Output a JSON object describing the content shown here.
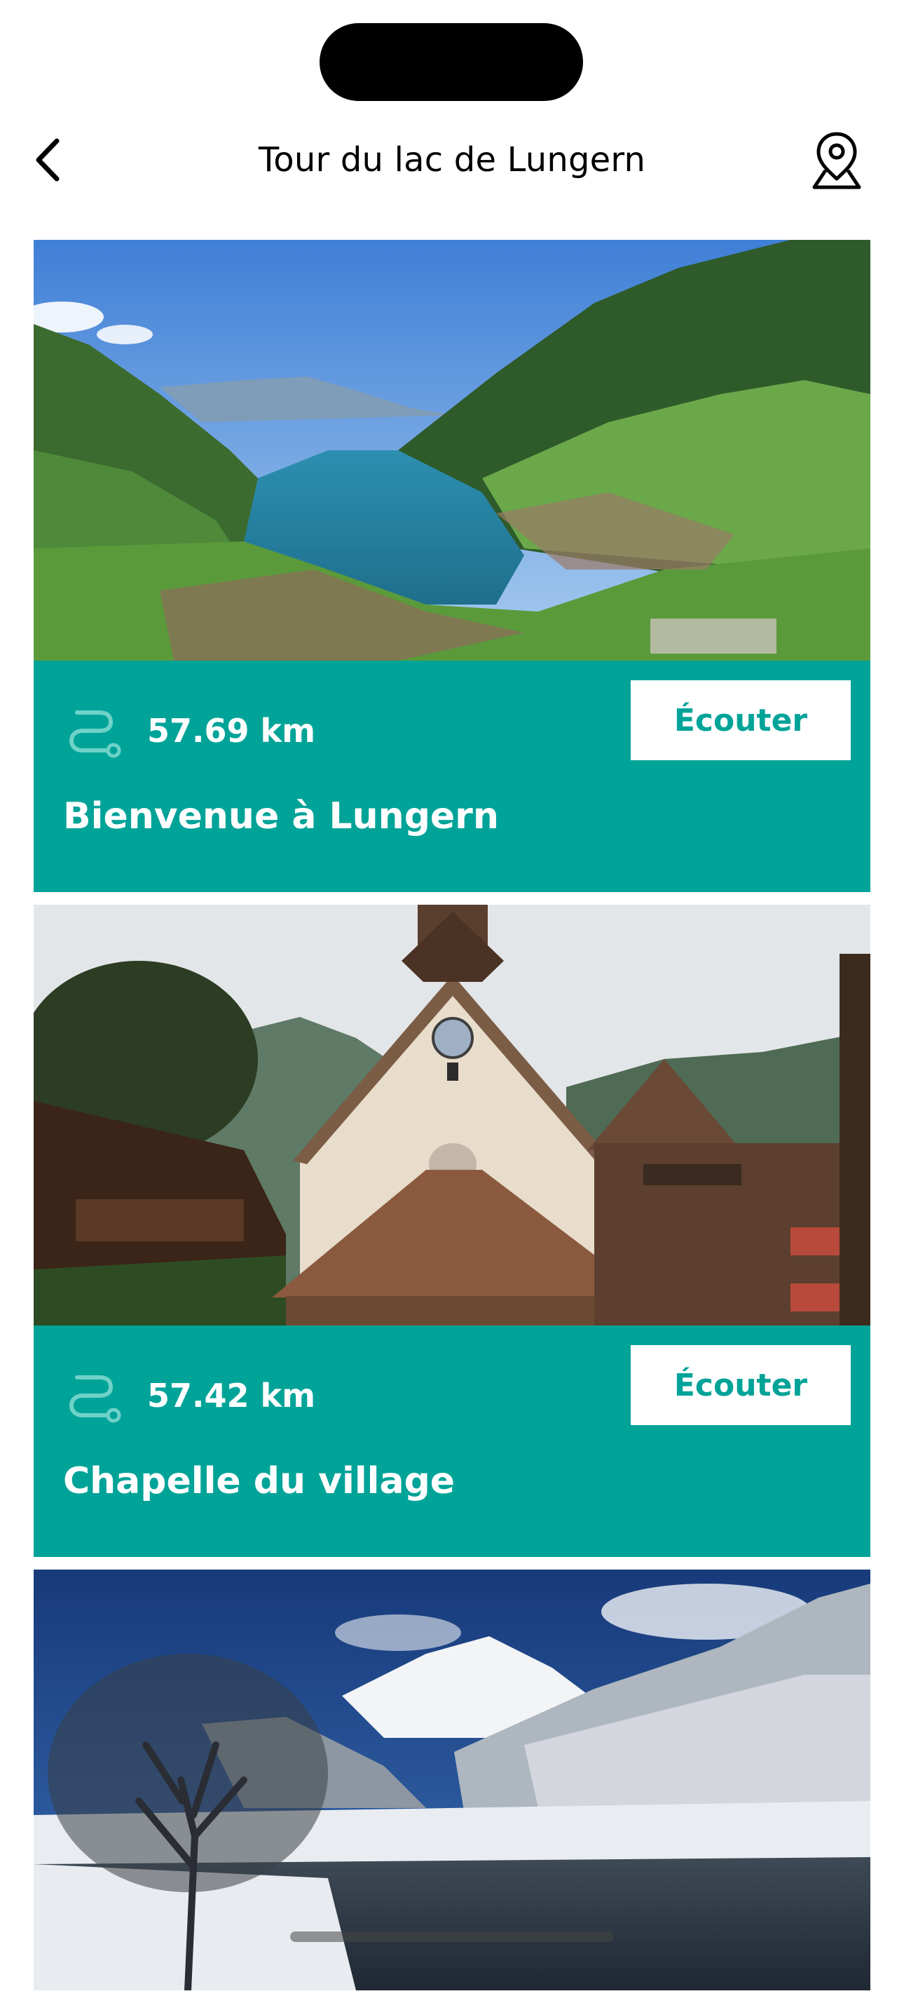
{
  "header": {
    "title": "Tour du lac de Lungern",
    "back_icon": "chevron-left-icon",
    "map_icon": "map-pin-icon"
  },
  "theme": {
    "accent": "#00a398",
    "button_bg": "#ffffff",
    "text_on_accent": "#ffffff"
  },
  "stops": [
    {
      "photo_subject": "aerial-lake-valley",
      "route_icon": "route-icon",
      "distance": "57.69 km",
      "listen_label": "Écouter",
      "title": "Bienvenue à Lungern"
    },
    {
      "photo_subject": "village-chapel",
      "route_icon": "route-icon",
      "distance": "57.42 km",
      "listen_label": "Écouter",
      "title": "Chapelle du village"
    },
    {
      "photo_subject": "winter-lake-mountain"
    }
  ]
}
